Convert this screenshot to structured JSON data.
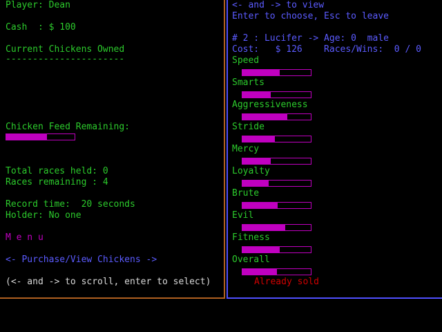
{
  "left": {
    "player_label": "Player: Dean",
    "cash_label": "Cash  : $ 100",
    "chickens_heading": "Current Chickens Owned",
    "chickens_underline": "----------------------",
    "feed_label": "Chicken Feed Remaining:",
    "feed_level": 0.6,
    "total_races": "Total races held: 0",
    "races_remaining": "Races remaining : 4",
    "record_time": "Record time:  20 seconds",
    "holder": "Holder: No one",
    "menu_title": "M e n u",
    "menu_item": "<- Purchase/View Chickens ->",
    "help_text": "(<- and -> to scroll, enter to select)"
  },
  "right": {
    "nav_hint": "<- and -> to view",
    "choose_hint": "Enter to choose, Esc to leave",
    "chicken_header": "# 2 : Lucifer -> Age: 0  male",
    "cost_line": "Cost:   $ 126    Races/Wins:  0 / 0",
    "stats": [
      {
        "label": "Speed",
        "level": 0.55
      },
      {
        "label": "Smarts",
        "level": 0.41
      },
      {
        "label": "Aggressiveness",
        "level": 0.66
      },
      {
        "label": "Stride",
        "level": 0.47
      },
      {
        "label": "Mercy",
        "level": 0.41
      },
      {
        "label": "Loyalty",
        "level": 0.38
      },
      {
        "label": "Brute",
        "level": 0.52
      },
      {
        "label": "Evil",
        "level": 0.63
      },
      {
        "label": "Fitness",
        "level": 0.55
      },
      {
        "label": "Overall",
        "level": 0.51
      }
    ],
    "status": "Already sold"
  },
  "colors": {
    "text_green": "#2ccb2c",
    "text_blue": "#5b5bff",
    "bar_magenta": "#c000c0",
    "sold_red": "#d00000",
    "left_border": "#b06020",
    "right_border": "#5050ff"
  }
}
